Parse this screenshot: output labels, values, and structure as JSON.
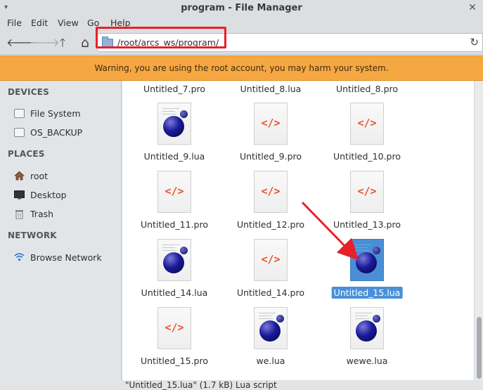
{
  "window": {
    "title": "program - File Manager",
    "menu_icon": "▾",
    "close": "✕"
  },
  "menubar": {
    "items": [
      "File",
      "Edit",
      "View",
      "Go",
      "Help"
    ]
  },
  "toolbar": {
    "back": "🡐",
    "forward": "🡒",
    "up": "🡑",
    "home": "⌂",
    "address": "/root/arcs_ws/program/",
    "reload": "↻"
  },
  "warning": "Warning, you are using the root account, you may harm your system.",
  "sidebar": {
    "devices_heading": "DEVICES",
    "devices": [
      {
        "label": "File System",
        "icon": "drive-icon"
      },
      {
        "label": "OS_BACKUP",
        "icon": "drive-icon"
      }
    ],
    "places_heading": "PLACES",
    "places": [
      {
        "label": "root",
        "icon": "home-icon"
      },
      {
        "label": "Desktop",
        "icon": "desktop-icon"
      },
      {
        "label": "Trash",
        "icon": "trash-icon"
      }
    ],
    "network_heading": "NETWORK",
    "network": [
      {
        "label": "Browse Network",
        "icon": "wifi-icon"
      }
    ]
  },
  "files": [
    {
      "name": "Untitled_7.pro",
      "type": "pro",
      "partial": true
    },
    {
      "name": "Untitled_8.lua",
      "type": "lua",
      "partial": true
    },
    {
      "name": "Untitled_8.pro",
      "type": "pro",
      "partial": true
    },
    {
      "name": "Untitled_9.lua",
      "type": "lua"
    },
    {
      "name": "Untitled_9.pro",
      "type": "pro"
    },
    {
      "name": "Untitled_10.pro",
      "type": "pro"
    },
    {
      "name": "Untitled_11.pro",
      "type": "pro"
    },
    {
      "name": "Untitled_12.pro",
      "type": "pro"
    },
    {
      "name": "Untitled_13.pro",
      "type": "pro"
    },
    {
      "name": "Untitled_14.lua",
      "type": "lua"
    },
    {
      "name": "Untitled_14.pro",
      "type": "pro"
    },
    {
      "name": "Untitled_15.lua",
      "type": "lua",
      "selected": true
    },
    {
      "name": "Untitled_15.pro",
      "type": "pro"
    },
    {
      "name": "we.lua",
      "type": "lua"
    },
    {
      "name": "wewe.lua",
      "type": "lua"
    }
  ],
  "code_glyph": "</>",
  "status": "\"Untitled_15.lua\" (1.7 kB) Lua script",
  "colors": {
    "warning_bg": "#f5a742",
    "selection": "#4a90d9",
    "annotation": "#e8202a"
  }
}
